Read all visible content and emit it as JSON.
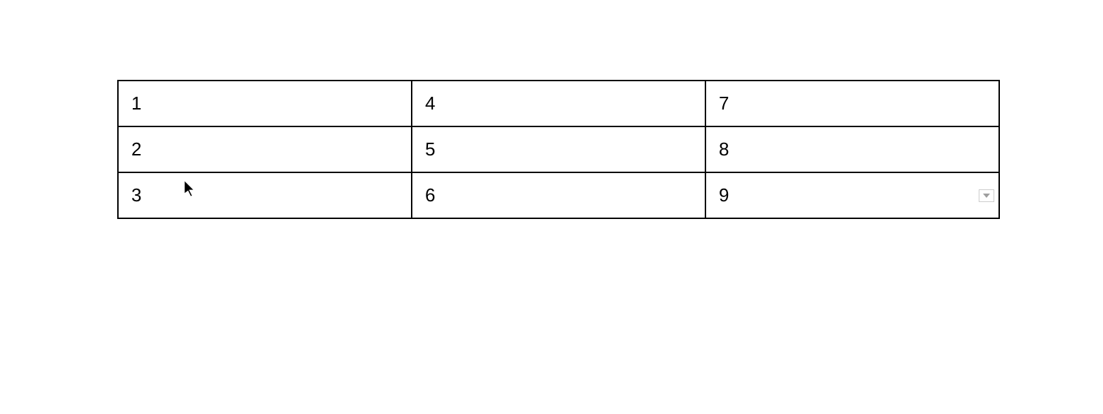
{
  "table": {
    "rows": [
      {
        "cells": [
          "1",
          "4",
          "7"
        ]
      },
      {
        "cells": [
          "2",
          "5",
          "8"
        ]
      },
      {
        "cells": [
          "3",
          "6",
          "9"
        ]
      }
    ]
  }
}
